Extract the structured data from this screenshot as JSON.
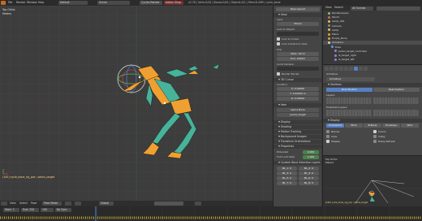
{
  "info_header": {
    "menu_items": [
      "File",
      "Render",
      "Window",
      "Help"
    ],
    "editor_type": "Default",
    "scene": "Scene",
    "engine": "Cycles Render",
    "addon_button": "Addon Shop",
    "stats": "v2.78 | Verts:0/44 | Bones:0/44 | Objects:0/1 | Mem:8.40M | cycle_bone"
  },
  "viewport": {
    "view_label": "Top Ortho",
    "units_label": "Meters",
    "selection_label": "(100) cycle_bone_rig_pos : pelvis_target"
  },
  "viewport_footer": {
    "items": [
      "View",
      "Select",
      "Pose",
      "Pose Mode",
      "Global"
    ]
  },
  "n_panel": {
    "header_button": "New Layout",
    "view_section": "View",
    "lens_label": "Lens:",
    "lens_value": "35mm",
    "lock_object_label": "Lock to Object:",
    "lock_cursor_label": "Lock to Cursor",
    "lock_camera_label": "Lock Camera to View",
    "clip_label": "Clip:",
    "clip_start": "Start: 10cm",
    "clip_end": "End: 1000m",
    "local_camera_label": "Local Camera:",
    "render_border_label": "Render Border",
    "cursor_section": "3D Cursor",
    "location_label": "Location:",
    "cursor_x": "X: 0.00000",
    "cursor_y": "Y: 3.00000 m",
    "cursor_z": "Z: 0.00000",
    "item_section": "Item",
    "item_name": "Game Bone",
    "item_sub": "pelvis_target",
    "display_section": "Display",
    "shading_section": "Shading",
    "motion_tracking_section": "Motion Tracking",
    "background_section": "Background Images",
    "transform_orientations_section": "Transform Orientations",
    "properties_section": "Properties",
    "extended_label": "Extended",
    "extended_value": "0.000",
    "foot_tilt_label": "Foot Lock Rate",
    "foot_tilt_value": "1.000",
    "custom_props_label": "Custom Bone Selection Layers",
    "bone_layers": [
      "BL_1: 0",
      "BL_2: 0",
      "BL_3: 0",
      "BL_4: 0",
      "BL_5: 0",
      "BL_6: 0",
      "BL_7: 0",
      "BL_8: 0"
    ]
  },
  "outliner": {
    "header": {
      "view": "View",
      "search": "Search",
      "scope": "All Scenes"
    },
    "rows": [
      {
        "name": "RenderLayers",
        "color": "#8fbf5f"
      },
      {
        "name": "World",
        "color": "#c76b6b"
      },
      {
        "name": "Lamp_001",
        "color": "#d9c561"
      },
      {
        "name": "Camera",
        "color": "#8a8a8a"
      },
      {
        "name": "Lamp",
        "color": "#d9c561"
      },
      {
        "name": "Plane",
        "color": "#e0a040"
      },
      {
        "name": "Empty_Bone",
        "color": "#e0a040"
      },
      {
        "name": "Armature",
        "color": "#d0d0d0"
      },
      {
        "name": "Pose",
        "color": "#5f9fd9"
      },
      {
        "name": "pelvis_target_controller",
        "color": "#9a7fd0"
      },
      {
        "name": "ik_target_right",
        "color": "#9a7fd0"
      },
      {
        "name": "ik_target_left",
        "color": "#9a7fd0"
      }
    ]
  },
  "properties": {
    "context_name": "Armature",
    "data_label": "Armature",
    "skeleton_section": "Skeleton",
    "pose_position_button": "Pose Position",
    "rest_position_button": "Rest Position",
    "layers_label": "Layers:",
    "protected_layers_label": "Protected Layers:",
    "display_section": "Display",
    "display_modes": [
      "Octahedral",
      "Stick",
      "B-Bone",
      "Envelope",
      "Wire"
    ],
    "options": [
      "Names",
      "Axes",
      "Shapes",
      "Colors",
      "X-Ray",
      "Delay Refresh"
    ]
  },
  "timeline": {
    "start": "Start: 1",
    "end": "End: 250",
    "frame": "100",
    "sync": "No Sync"
  },
  "mini_view": {
    "view_label": "Top Ortho",
    "units_label": "Meters",
    "selection_label": "(100) cycle_bone_rig_pos : pelvis_target"
  },
  "colors": {
    "accent_blue": "#5680c2",
    "bone_orange": "#f0a030",
    "bone_teal": "#46b39a",
    "field_green": "#4e7f4e"
  }
}
